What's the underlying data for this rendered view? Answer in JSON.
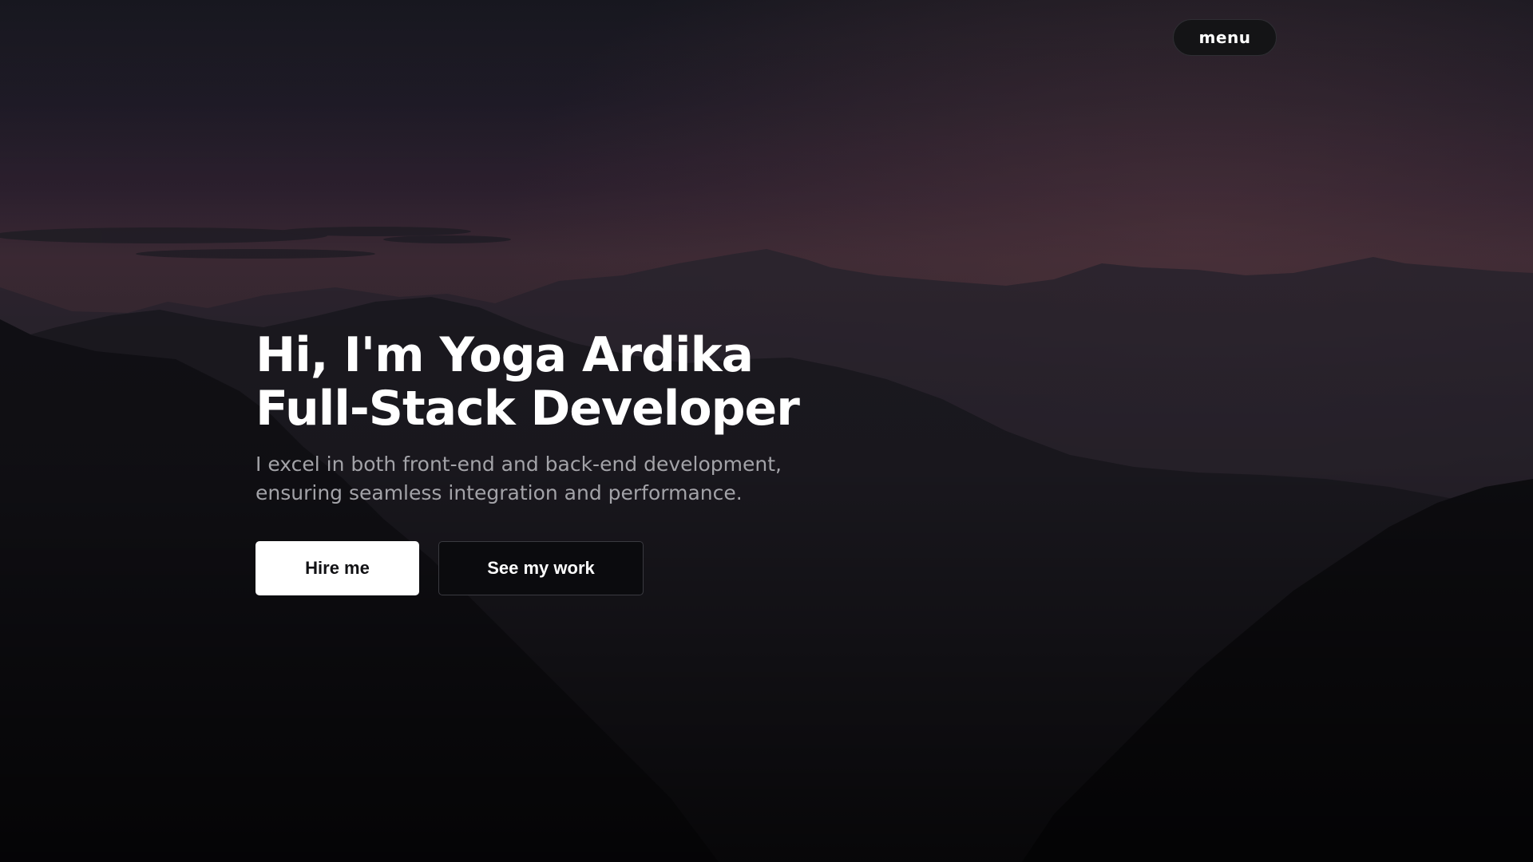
{
  "nav": {
    "menu_label": "menu"
  },
  "hero": {
    "title_line1": "Hi, I'm Yoga Ardika",
    "title_line2": "Full-Stack Developer",
    "description": "I excel in both front-end and back-end development, ensuring seamless integration and performance.",
    "primary_button": "Hire me",
    "secondary_button": "See my work"
  },
  "colors": {
    "background": "#0a0a0d",
    "sky_top": "#1a1a22",
    "sky_glow": "#4a3340",
    "text_primary": "#ffffff",
    "text_muted": "#a3a3a8",
    "button_primary_bg": "#ffffff",
    "button_secondary_border": "#3a3a40"
  }
}
